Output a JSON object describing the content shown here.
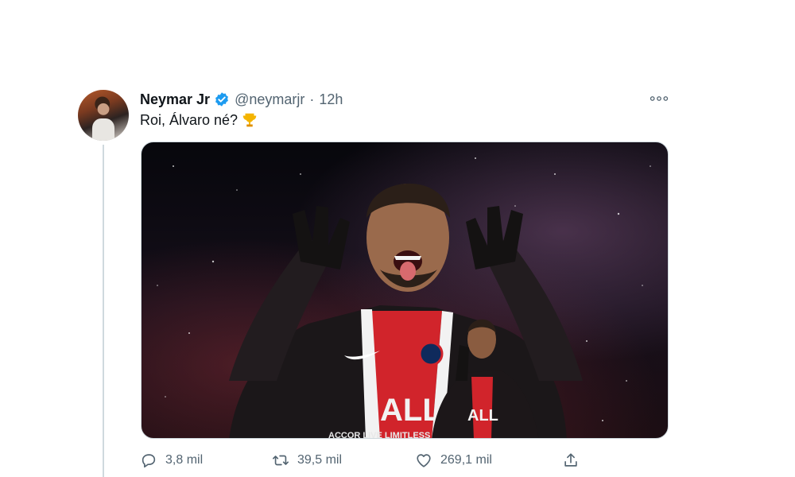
{
  "tweet": {
    "author_name": "Neymar Jr",
    "handle": "@neymarjr",
    "separator": "·",
    "time": "12h",
    "text": "Roi, Álvaro né?",
    "emoji": "trophy-icon",
    "media": {
      "jersey_text": "ALL",
      "sponsor_text": "ACCOR LIVE LIMITLESS",
      "small_jersey_text": "ALL"
    },
    "stats": {
      "replies": "3,8 mil",
      "retweets": "39,5 mil",
      "likes": "269,1 mil"
    }
  },
  "colors": {
    "verified": "#1d9bf0",
    "secondary_text": "#536471",
    "thread_line": "#cfd9de",
    "psg_red": "#d1242b"
  },
  "icons": [
    "verified-badge-icon",
    "more-icon",
    "trophy-icon",
    "reply-icon",
    "retweet-icon",
    "like-icon",
    "share-icon"
  ]
}
